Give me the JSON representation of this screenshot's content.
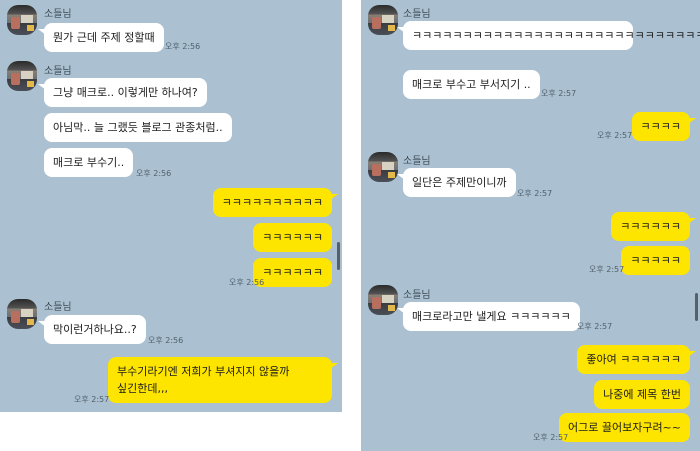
{
  "left": {
    "sender_name_1": "소들님",
    "m1": "뭔가 근데 주제 정할때",
    "t1": "오후 2:56",
    "sender_name_2": "소들님",
    "m2": "그냥 매크로.. 이렇게만 하나여?",
    "m3": "아님막.. 늘 그랬듯 블로그 관종처럼..",
    "m4": "매크로 부수기..",
    "t2": "오후 2:56",
    "m5": "ㅋㅋㅋㅋㅋㅋㅋㅋㅋㅋ",
    "m6": "ㅋㅋㅋㅋㅋㅋ",
    "m7": "ㅋㅋㅋㅋㅋㅋ",
    "t3": "오후 2:56",
    "sender_name_3": "소들님",
    "m8": "막이런거하나요..?",
    "t4": "오후 2:56",
    "m9": "부수기라기엔 저희가 부셔지지 않을까 싶긴한데,,,",
    "t5": "오후 2:57"
  },
  "right": {
    "sender_name_1": "소들님",
    "m1": "ㅋㅋㅋㅋㅋㅋㅋㅋㅋㅋㅋㅋㅋㅋㅋㅋㅋㅋㅋㅋㅋㅋㅋㅋㅋㅋㅋㅋㅋ",
    "m2": "매크로 부수고 부서지기 ..",
    "t1": "오후 2:57",
    "m3": "ㅋㅋㅋㅋ",
    "t2": "오후 2:57",
    "sender_name_2": "소들님",
    "m4": "일단은 주제만이니까",
    "t3": "오후 2:57",
    "m5": "ㅋㅋㅋㅋㅋㅋ",
    "m6": "ㅋㅋㅋㅋㅋ",
    "t4": "오후 2:57",
    "sender_name_3": "소들님",
    "m7": "매크로라고만 낼게요 ㅋㅋㅋㅋㅋㅋ",
    "t5": "오후 2:57",
    "m8": "좋아여 ㅋㅋㅋㅋㅋㅋ",
    "m9": "나중에 제목 한번",
    "m10": "어그로 끌어보자구려~~",
    "t6": "오후 2:57"
  },
  "colors": {
    "chat_background": "#abc1d1",
    "my_bubble": "#fee500",
    "their_bubble": "#ffffff"
  }
}
